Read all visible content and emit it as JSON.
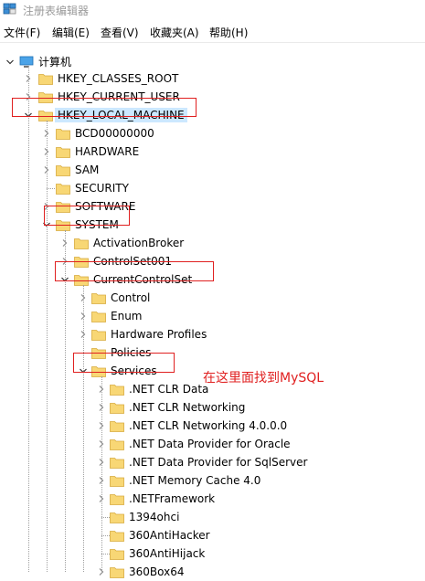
{
  "window": {
    "title": "注册表编辑器"
  },
  "menu": [
    {
      "label": "文件(F)"
    },
    {
      "label": "编辑(E)"
    },
    {
      "label": "查看(V)"
    },
    {
      "label": "收藏夹(A)"
    },
    {
      "label": "帮助(H)"
    }
  ],
  "tree": {
    "root": "计算机",
    "nodes": [
      {
        "label": "HKEY_CLASSES_ROOT",
        "state": "collapsed"
      },
      {
        "label": "HKEY_CURRENT_USER",
        "state": "collapsed"
      },
      {
        "label": "HKEY_LOCAL_MACHINE",
        "state": "expanded",
        "selected": true
      },
      {
        "label": "BCD00000000",
        "state": "collapsed"
      },
      {
        "label": "HARDWARE",
        "state": "collapsed"
      },
      {
        "label": "SAM",
        "state": "collapsed"
      },
      {
        "label": "SECURITY",
        "state": "leaf"
      },
      {
        "label": "SOFTWARE",
        "state": "collapsed"
      },
      {
        "label": "SYSTEM",
        "state": "expanded"
      },
      {
        "label": "ActivationBroker",
        "state": "collapsed"
      },
      {
        "label": "ControlSet001",
        "state": "collapsed"
      },
      {
        "label": "CurrentControlSet",
        "state": "expanded"
      },
      {
        "label": "Control",
        "state": "collapsed"
      },
      {
        "label": "Enum",
        "state": "collapsed"
      },
      {
        "label": "Hardware Profiles",
        "state": "collapsed"
      },
      {
        "label": "Policies",
        "state": "leaf"
      },
      {
        "label": "Services",
        "state": "expanded"
      },
      {
        "label": ".NET CLR Data",
        "state": "collapsed"
      },
      {
        "label": ".NET CLR Networking",
        "state": "collapsed"
      },
      {
        "label": ".NET CLR Networking 4.0.0.0",
        "state": "collapsed"
      },
      {
        "label": ".NET Data Provider for Oracle",
        "state": "collapsed"
      },
      {
        "label": ".NET Data Provider for SqlServer",
        "state": "collapsed"
      },
      {
        "label": ".NET Memory Cache 4.0",
        "state": "collapsed"
      },
      {
        "label": ".NETFramework",
        "state": "collapsed"
      },
      {
        "label": "1394ohci",
        "state": "leaf"
      },
      {
        "label": "360AntiHacker",
        "state": "leaf"
      },
      {
        "label": "360AntiHijack",
        "state": "leaf"
      },
      {
        "label": "360Box64",
        "state": "collapsed"
      }
    ]
  },
  "annotation": {
    "text": "在这里面找到MySQL"
  },
  "colors": {
    "annotation": "#e02020",
    "folder": "#f8d775",
    "selection": "#cce8ff"
  },
  "icons": {
    "app": "registry-editor-icon",
    "root": "computer-icon",
    "node": "folder-icon"
  }
}
